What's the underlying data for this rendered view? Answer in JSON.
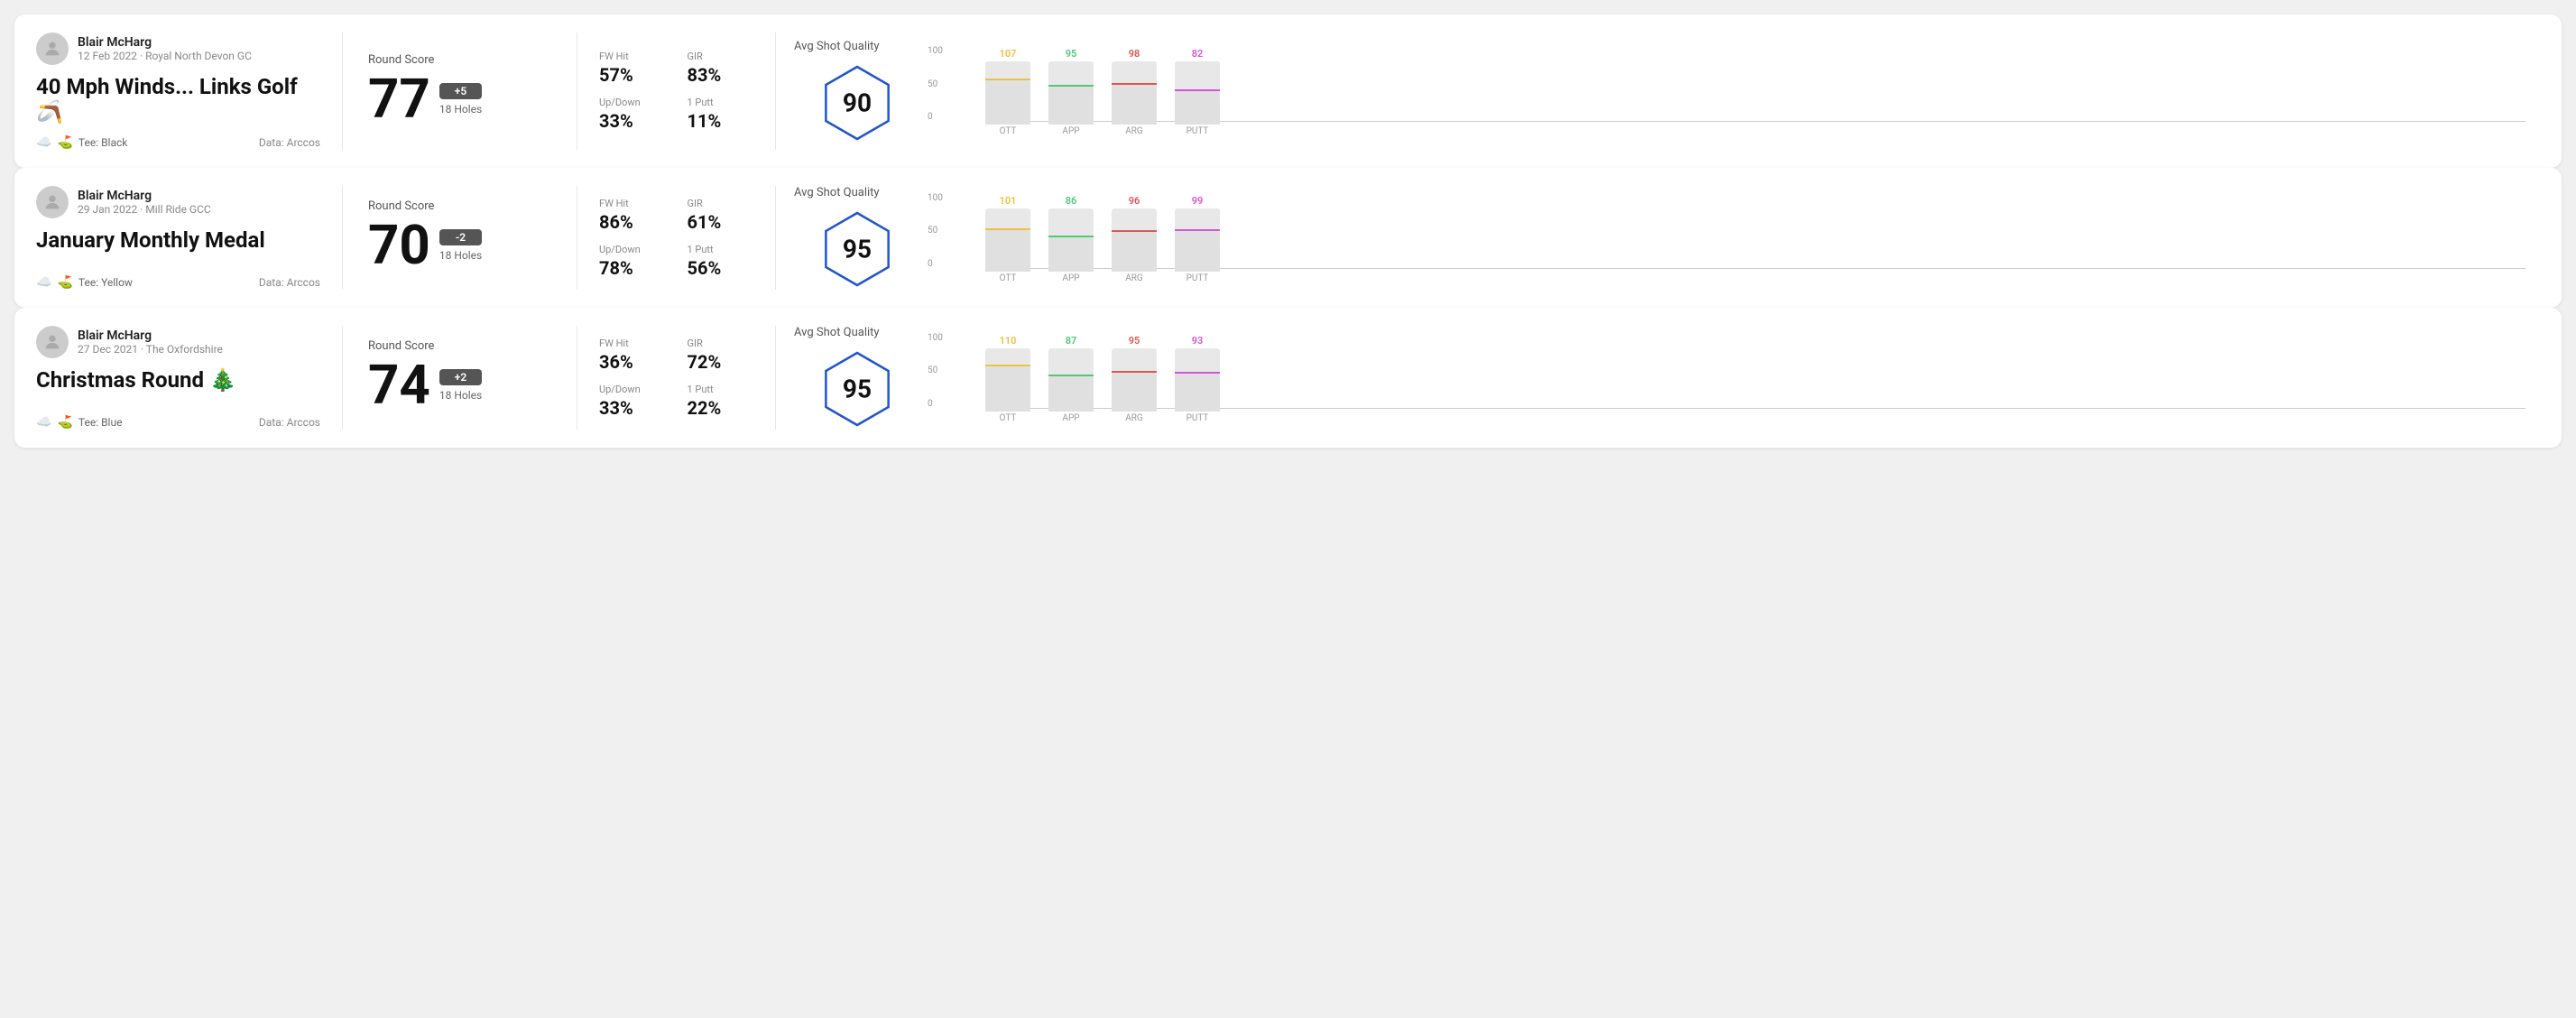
{
  "rounds": [
    {
      "id": "round-1",
      "user": {
        "name": "Blair McHarg",
        "date": "12 Feb 2022",
        "venue": "Royal North Devon GC"
      },
      "title": "40 Mph Winds... Links Golf 🪃",
      "tee": "Black",
      "data_source": "Data: Arccos",
      "score": {
        "label": "Round Score",
        "number": "77",
        "badge": "+5",
        "holes": "18 Holes"
      },
      "stats": {
        "fw_hit_label": "FW Hit",
        "fw_hit_value": "57%",
        "gir_label": "GIR",
        "gir_value": "83%",
        "updown_label": "Up/Down",
        "updown_value": "33%",
        "oneputt_label": "1 Putt",
        "oneputt_value": "11%"
      },
      "quality": {
        "label": "Avg Shot Quality",
        "score": "90"
      },
      "chart": {
        "bars": [
          {
            "label": "OTT",
            "value": 107,
            "color": "#f0c040",
            "bar_pct": 72
          },
          {
            "label": "APP",
            "value": 95,
            "color": "#50c878",
            "bar_pct": 62
          },
          {
            "label": "ARG",
            "value": 98,
            "color": "#e05555",
            "bar_pct": 65
          },
          {
            "label": "PUTT",
            "value": 82,
            "color": "#d455d4",
            "bar_pct": 54
          }
        ]
      }
    },
    {
      "id": "round-2",
      "user": {
        "name": "Blair McHarg",
        "date": "29 Jan 2022",
        "venue": "Mill Ride GCC"
      },
      "title": "January Monthly Medal",
      "tee": "Yellow",
      "data_source": "Data: Arccos",
      "score": {
        "label": "Round Score",
        "number": "70",
        "badge": "-2",
        "holes": "18 Holes"
      },
      "stats": {
        "fw_hit_label": "FW Hit",
        "fw_hit_value": "86%",
        "gir_label": "GIR",
        "gir_value": "61%",
        "updown_label": "Up/Down",
        "updown_value": "78%",
        "oneputt_label": "1 Putt",
        "oneputt_value": "56%"
      },
      "quality": {
        "label": "Avg Shot Quality",
        "score": "95"
      },
      "chart": {
        "bars": [
          {
            "label": "OTT",
            "value": 101,
            "color": "#f0c040",
            "bar_pct": 68
          },
          {
            "label": "APP",
            "value": 86,
            "color": "#50c878",
            "bar_pct": 56
          },
          {
            "label": "ARG",
            "value": 96,
            "color": "#e05555",
            "bar_pct": 64
          },
          {
            "label": "PUTT",
            "value": 99,
            "color": "#d455d4",
            "bar_pct": 66
          }
        ]
      }
    },
    {
      "id": "round-3",
      "user": {
        "name": "Blair McHarg",
        "date": "27 Dec 2021",
        "venue": "The Oxfordshire"
      },
      "title": "Christmas Round 🎄",
      "tee": "Blue",
      "data_source": "Data: Arccos",
      "score": {
        "label": "Round Score",
        "number": "74",
        "badge": "+2",
        "holes": "18 Holes"
      },
      "stats": {
        "fw_hit_label": "FW Hit",
        "fw_hit_value": "36%",
        "gir_label": "GIR",
        "gir_value": "72%",
        "updown_label": "Up/Down",
        "updown_value": "33%",
        "oneputt_label": "1 Putt",
        "oneputt_value": "22%"
      },
      "quality": {
        "label": "Avg Shot Quality",
        "score": "95"
      },
      "chart": {
        "bars": [
          {
            "label": "OTT",
            "value": 110,
            "color": "#f0c040",
            "bar_pct": 74
          },
          {
            "label": "APP",
            "value": 87,
            "color": "#50c878",
            "bar_pct": 57
          },
          {
            "label": "ARG",
            "value": 95,
            "color": "#e05555",
            "bar_pct": 63
          },
          {
            "label": "PUTT",
            "value": 93,
            "color": "#d455d4",
            "bar_pct": 62
          }
        ]
      }
    }
  ],
  "chart_y_labels": [
    "100",
    "50",
    "0"
  ]
}
